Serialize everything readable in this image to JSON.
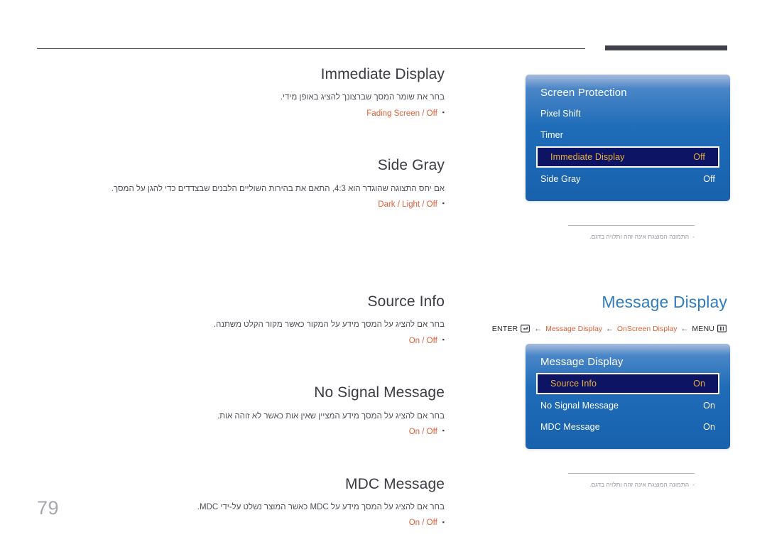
{
  "page": {
    "number": "79"
  },
  "left_topics_upper": [
    {
      "title": "Immediate Display",
      "description": "בחר את שומר המסך שברצונך להציג באופן מידי.",
      "options": "Fading Screen / Off"
    },
    {
      "title": "Side Gray",
      "description": "אם יחס התצוגה שהוגדר הוא 4:3, התאם את בהירות השוליים הלבנים שבצדדים כדי להגן על המסך.",
      "options": "Dark / Light / Off"
    }
  ],
  "left_topics_lower": [
    {
      "title": "Source Info",
      "description": "בחר אם להציג על המסך מידע על המקור כאשר מקור הקלט משתנה.",
      "options": "On / Off"
    },
    {
      "title": "No Signal Message",
      "description": "בחר אם להציג על המסך מידע המציין שאין אות כאשר לא זוהה אות.",
      "options": "On / Off"
    },
    {
      "title": "MDC Message",
      "description": "בחר אם להציג על המסך מידע על MDC כאשר המוצר נשלט על-ידי MDC.",
      "options": "On / Off"
    }
  ],
  "right_upper": {
    "panel": {
      "title": "Screen Protection",
      "rows": [
        {
          "label": "Pixel Shift",
          "value": "",
          "selected": false
        },
        {
          "label": "Timer",
          "value": "",
          "selected": false
        },
        {
          "label": "Immediate Display",
          "value": "Off",
          "selected": true
        },
        {
          "label": "Side Gray",
          "value": "Off",
          "selected": false
        }
      ]
    },
    "footnote": "התמונה המוצגת אינה זהה ותלויה בדגם.",
    "footnote_dash": "-"
  },
  "right_lower": {
    "section_title": "Message Display",
    "breadcrumb": {
      "enter_label": "ENTER",
      "enter_icon": "enter-key-icon",
      "arrow": "←",
      "crumb1": "Message Display",
      "crumb2": "OnScreen Display",
      "menu_label": "MENU",
      "menu_icon": "menu-grid-icon"
    },
    "panel": {
      "title": "Message Display",
      "rows": [
        {
          "label": "Source Info",
          "value": "On",
          "selected": true
        },
        {
          "label": "No Signal Message",
          "value": "On",
          "selected": false
        },
        {
          "label": "MDC Message",
          "value": "On",
          "selected": false
        }
      ]
    },
    "footnote": "התמונה המוצגת אינה זהה ותלויה בדגם.",
    "footnote_dash": "-"
  },
  "colors": {
    "accent_orange": "#e0613a",
    "title_blue": "#2f7cc0",
    "panel_blue": "#1f6cb8",
    "selected_navy": "#0d1464",
    "selected_amber": "#e8b23c",
    "heading_dark": "#3b3b44"
  }
}
